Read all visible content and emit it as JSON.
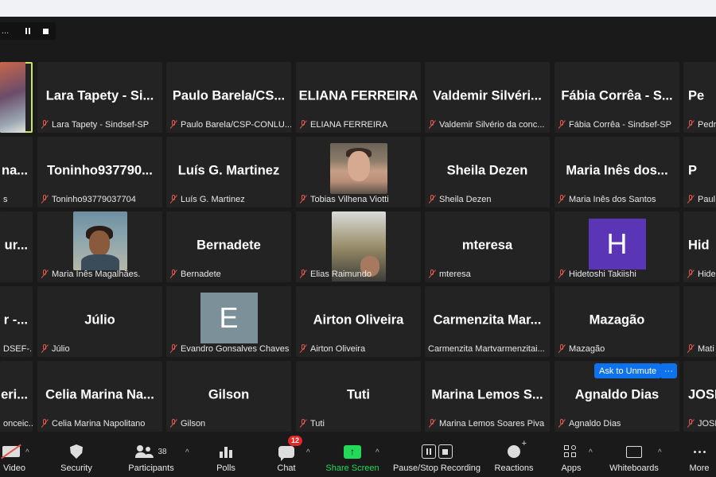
{
  "window": {
    "recording_controls_label": "..."
  },
  "tiles": [
    {
      "id": "r1c0",
      "name": "",
      "label": ""
    },
    {
      "id": "r1c1",
      "name": "Lara Tapety - Si...",
      "label": "Lara Tapety - Sindsef-SP"
    },
    {
      "id": "r1c2",
      "name": "Paulo Barela/CS...",
      "label": "Paulo Barela/CSP-CONLU..."
    },
    {
      "id": "r1c3",
      "name": "ELIANA FERREIRA",
      "label": "ELIANA FERREIRA"
    },
    {
      "id": "r1c4",
      "name": "Valdemir Silvéri...",
      "label": "Valdemir Silvério da conc..."
    },
    {
      "id": "r1c5",
      "name": "Fábia Corrêa - S...",
      "label": "Fábia Corrêa - Sindsef-SP"
    },
    {
      "id": "r1c6",
      "name": "Pe",
      "label": "Pedr"
    },
    {
      "id": "r2c0",
      "name": "na...",
      "label": "s"
    },
    {
      "id": "r2c1",
      "name": "Toninho937790...",
      "label": "Toninho93779037704"
    },
    {
      "id": "r2c2",
      "name": "Luís G. Martinez",
      "label": "Luís G. Martinez"
    },
    {
      "id": "r2c3",
      "name": "",
      "label": "Tobias Vilhena Viotti"
    },
    {
      "id": "r2c4",
      "name": "Sheila Dezen",
      "label": "Sheila Dezen"
    },
    {
      "id": "r2c5",
      "name": "Maria Inês dos...",
      "label": "Maria Inês dos Santos"
    },
    {
      "id": "r2c6",
      "name": "P",
      "label": "Paul"
    },
    {
      "id": "r3c0",
      "name": "ur...",
      "label": ""
    },
    {
      "id": "r3c1",
      "name": "",
      "label": "Maria Inês Magalhães."
    },
    {
      "id": "r3c2",
      "name": "Bernadete",
      "label": "Bernadete"
    },
    {
      "id": "r3c3",
      "name": "",
      "label": "Elias Raimundo"
    },
    {
      "id": "r3c4",
      "name": "mteresa",
      "label": "mteresa"
    },
    {
      "id": "r3c5",
      "name": "",
      "label": "Hidetoshi Takiishi",
      "initial": "H"
    },
    {
      "id": "r3c6",
      "name": "Hid",
      "label": "Hide"
    },
    {
      "id": "r4c0",
      "name": "r -...",
      "label": "DSEF-..."
    },
    {
      "id": "r4c1",
      "name": "Júlio",
      "label": "Júlio"
    },
    {
      "id": "r4c2",
      "name": "",
      "label": "Evandro Gonsalves Chaves",
      "initial": "E"
    },
    {
      "id": "r4c3",
      "name": "Airton Oliveira",
      "label": "Airton Oliveira"
    },
    {
      "id": "r4c4",
      "name": "Carmenzita Mar...",
      "label": "Carmenzita Martvarmenzitai..."
    },
    {
      "id": "r4c5",
      "name": "Mazagão",
      "label": "Mazagão"
    },
    {
      "id": "r4c6",
      "name": "",
      "label": "Mati"
    },
    {
      "id": "r5c0",
      "name": "eri...",
      "label": "onceic..."
    },
    {
      "id": "r5c1",
      "name": "Celia Marina Na...",
      "label": "Celia Marina Napolitano"
    },
    {
      "id": "r5c2",
      "name": "Gilson",
      "label": "Gilson"
    },
    {
      "id": "r5c3",
      "name": "Tuti",
      "label": "Tuti"
    },
    {
      "id": "r5c4",
      "name": "Marina Lemos S...",
      "label": "Marina Lemos Soares Piva"
    },
    {
      "id": "r5c5",
      "name": "Agnaldo Dias",
      "label": "Agnaldo Dias"
    },
    {
      "id": "r5c6",
      "name": "JOSE",
      "label": "JOSE LU"
    }
  ],
  "overlay": {
    "ask_to_unmute": "Ask to Unmute",
    "more_dots": "···"
  },
  "toolbar": {
    "video": "Video",
    "security": "Security",
    "participants": "Participants",
    "participants_count": "38",
    "polls": "Polls",
    "chat": "Chat",
    "chat_badge": "12",
    "share_screen": "Share Screen",
    "pause_stop_recording": "Pause/Stop Recording",
    "reactions": "Reactions",
    "apps": "Apps",
    "whiteboards": "Whiteboards",
    "more": "More"
  },
  "colors": {
    "accent_green": "#23d959",
    "active_speaker": "#c5e86c",
    "unmute_blue": "#0e72ed",
    "muted_red": "#e0584c"
  }
}
